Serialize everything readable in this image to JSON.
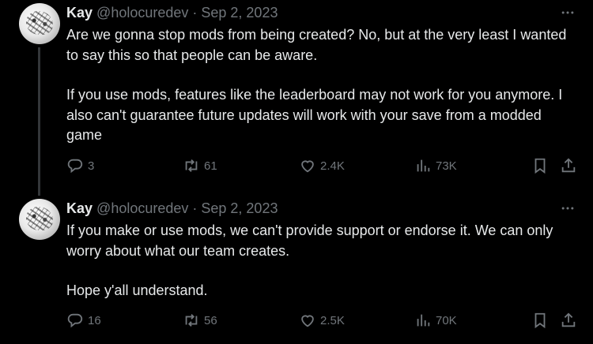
{
  "tweets": [
    {
      "name": "Kay",
      "handle_date": "@holocuredev · Sep 2, 2023",
      "paragraphs": [
        "Are we gonna stop mods from being created? No, but at the very least I wanted to say this so that people can be aware.",
        "If you use mods, features like the leaderboard may not work for you anymore. I also can't guarantee future updates will work with your save from a modded game"
      ],
      "replies": "3",
      "reposts": "61",
      "likes": "2.4K",
      "views": "73K"
    },
    {
      "name": "Kay",
      "handle_date": "@holocuredev · Sep 2, 2023",
      "paragraphs": [
        "If you make or use mods, we can't provide support or endorse it. We can only worry about what our team creates.",
        "Hope y'all understand."
      ],
      "replies": "16",
      "reposts": "56",
      "likes": "2.5K",
      "views": "70K"
    }
  ],
  "icons": {
    "more": "more-icon",
    "reply": "reply-icon",
    "repost": "repost-icon",
    "like": "heart-icon",
    "views": "views-icon",
    "bookmark": "bookmark-icon",
    "share": "share-icon"
  },
  "colors": {
    "background": "#000000",
    "text": "#e7e9ea",
    "muted": "#71767b",
    "thread_line": "#333639"
  }
}
